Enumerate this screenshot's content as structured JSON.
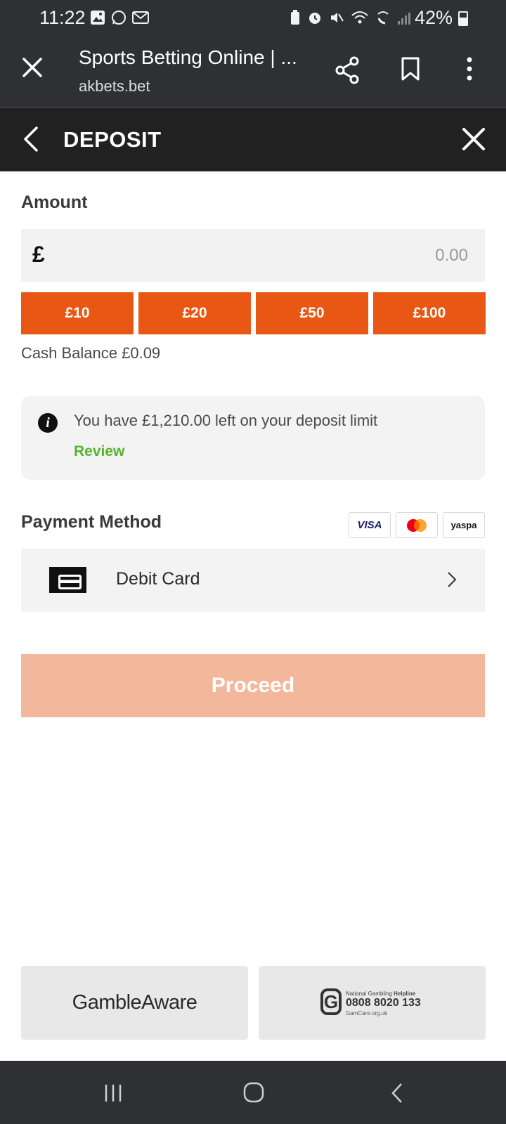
{
  "status_bar": {
    "time": "11:22",
    "battery": "42%"
  },
  "browser": {
    "page_title": "Sports Betting Online | ...",
    "domain": "akbets.bet"
  },
  "deposit": {
    "header_title": "DEPOSIT",
    "amount_label": "Amount",
    "currency_symbol": "£",
    "amount_placeholder": "0.00",
    "quick_amounts": [
      "£10",
      "£20",
      "£50",
      "£100"
    ],
    "cash_balance_label": "Cash Balance",
    "cash_balance_value": "£0.09",
    "limit_message": "You have £1,210.00 left on your deposit limit",
    "review_label": "Review",
    "payment_method_label": "Payment Method",
    "payment_logos": {
      "visa": "VISA",
      "yaspa": "yaspa"
    },
    "method_name": "Debit Card",
    "proceed_label": "Proceed"
  },
  "footer": {
    "gambleaware": "GambleAware",
    "helpline_prefix": "National Gambling",
    "helpline_bold": "Helpline",
    "helpline_number": "0808 8020 133",
    "helpline_site": "GamCare.org.uk"
  },
  "colors": {
    "accent": "#e85814",
    "proceed_disabled": "#f3b79c",
    "review_green": "#58b32c",
    "dark_header": "#212121",
    "browser_bar": "#2f3033"
  },
  "icons": [
    "close-icon",
    "share-icon",
    "bookmark-icon",
    "more-vert-icon",
    "back-chevron-icon",
    "info-icon",
    "card-icon",
    "chevron-right-icon"
  ]
}
